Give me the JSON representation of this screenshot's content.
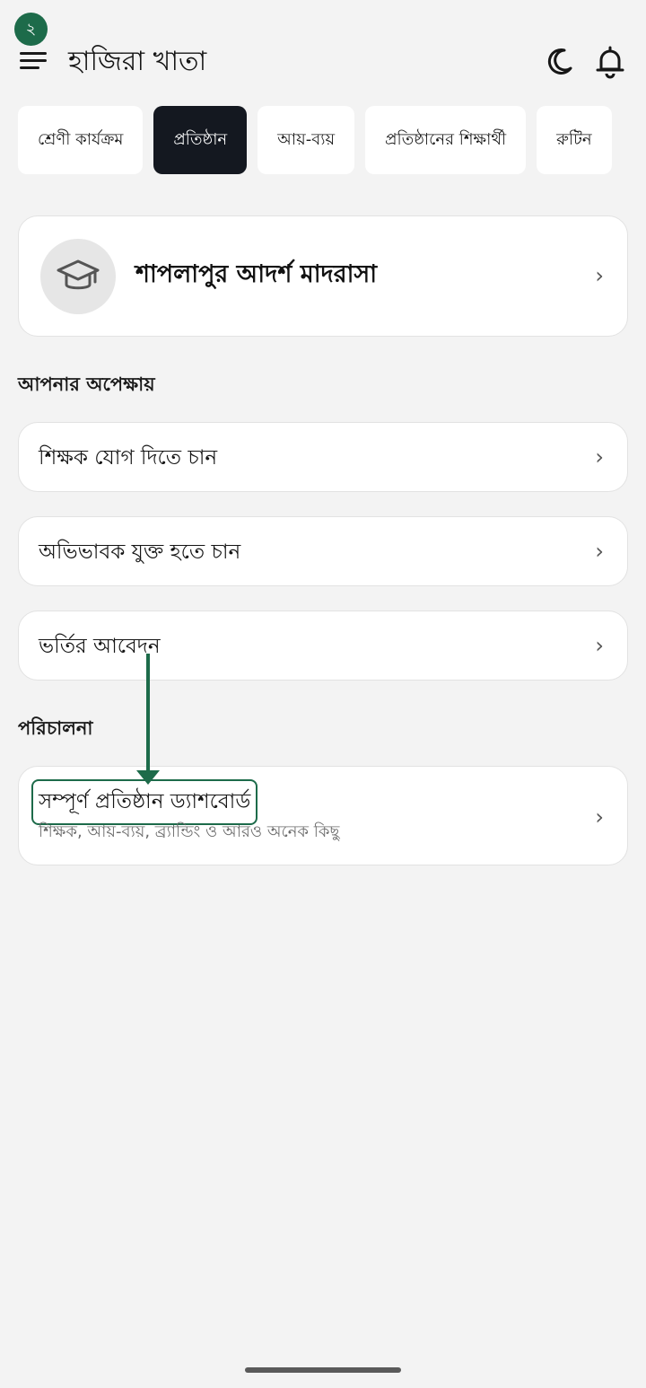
{
  "annotation": {
    "step": "২"
  },
  "header": {
    "title": "হাজিরা খাতা"
  },
  "tabs": [
    {
      "label": "শ্রেণী কার্যক্রম"
    },
    {
      "label": "প্রতিষ্ঠান"
    },
    {
      "label": "আয়-ব্যয়"
    },
    {
      "label": "প্রতিষ্ঠানের শিক্ষার্থী"
    },
    {
      "label": "রুটিন"
    }
  ],
  "active_tab": "প্রতিষ্ঠান",
  "institution": {
    "name": "শাপলাপুর আদর্শ মাদরাসা"
  },
  "pending": {
    "title": "আপনার অপেক্ষায়",
    "items": [
      {
        "label": "শিক্ষক যোগ দিতে চান"
      },
      {
        "label": "অভিভাবক যুক্ত হতে চান"
      },
      {
        "label": "ভর্তির আবেদন"
      }
    ]
  },
  "management": {
    "title": "পরিচালনা",
    "dashboard": {
      "title": "সম্পূর্ণ প্রতিষ্ঠান ড্যাশবোর্ড",
      "subtitle": "শিক্ষক, আয়-ব্যয়, ব্র্যান্ডিং ও আরও অনেক কিছু"
    }
  },
  "chevron": "›",
  "colors": {
    "accent": "#1d6b4a",
    "active_tab_bg": "#141820",
    "background": "#f3f3f3"
  },
  "icons": [
    "menu-icon",
    "moon-icon",
    "bell-icon",
    "graduation-cap-icon",
    "chevron-right-icon"
  ]
}
